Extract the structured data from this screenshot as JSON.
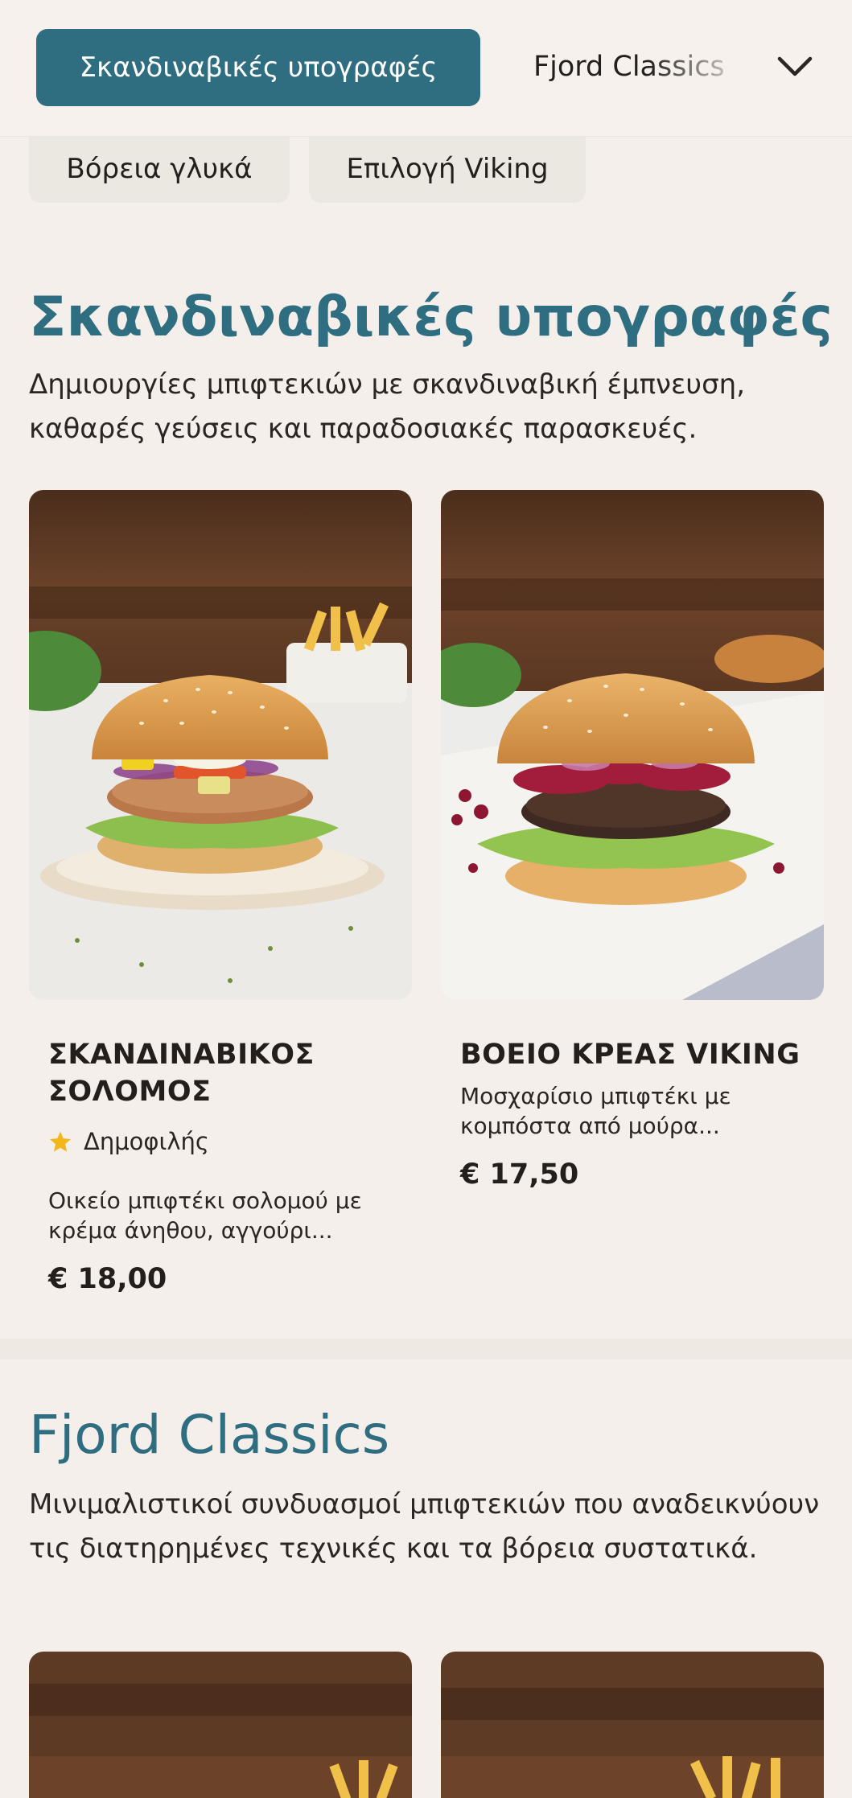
{
  "category_bar": {
    "active_label": "Σκανδιναβικές υπογραφές",
    "next_label": "Fjord Classics",
    "pills": [
      "Βόρεια γλυκά",
      "Επιλογή Viking"
    ]
  },
  "sections": [
    {
      "title": "Σκανδιναβικές υπογραφές",
      "description": "Δημιουργίες μπιφτεκιών με σκανδιναβική έμπνευση, καθαρές γεύσεις και παραδοσιακές παρασκευές.",
      "products": [
        {
          "name": "ΣΚΑΝΔΙΝΑΒΙΚΟΣ ΣΟΛΟΜΟΣ",
          "badge": "Δημοφιλής",
          "description": "Οικείο μπιφτέκι σολομού με κρέμα άνηθου, αγγούρι...",
          "price": "€ 18,00"
        },
        {
          "name": "ΒΟΕΙΟ ΚΡΕΑΣ VIKING",
          "description": "Μοσχαρίσιο μπιφτέκι με κομπόστα από μούρα...",
          "price": "€ 17,50"
        }
      ]
    },
    {
      "title": "Fjord Classics",
      "description": "Μινιμαλιστικοί συνδυασμοί μπιφτεκιών που αναδεικνύουν τις διατηρημένες τεχνικές και τα βόρεια συστατικά."
    }
  ],
  "icons": {
    "dropdown": "chevron-down-icon",
    "badge": "star-icon"
  },
  "colors": {
    "accent": "#2f6e80",
    "background": "#f5efeb",
    "pill": "#ebe7e1",
    "star": "#f2b81b"
  }
}
